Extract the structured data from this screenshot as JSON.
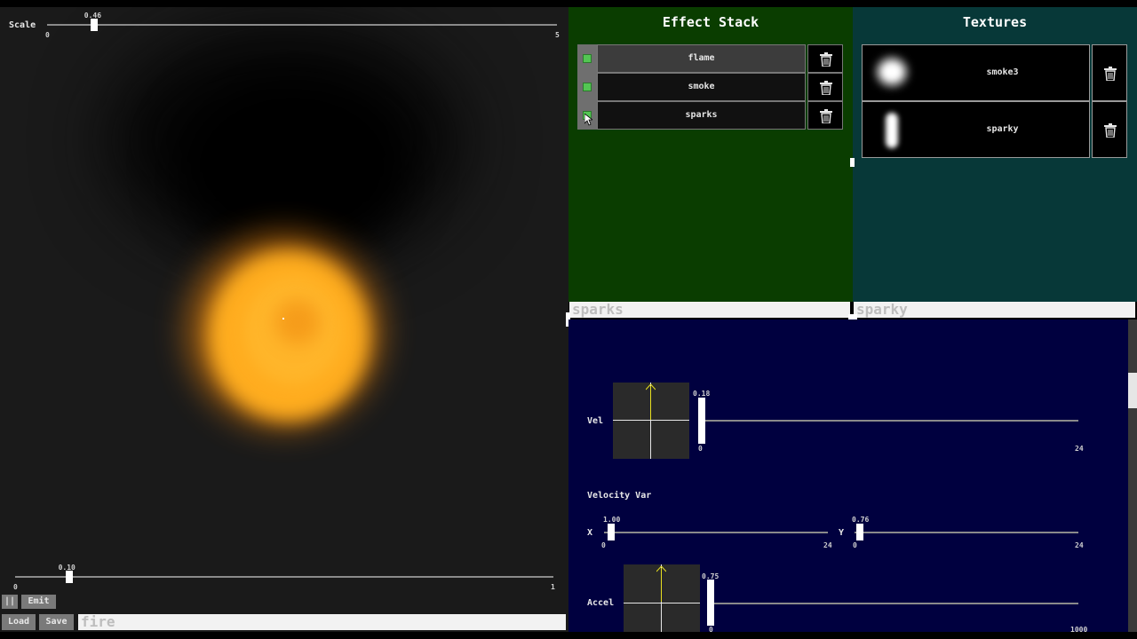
{
  "viewport": {
    "scale_label": "Scale",
    "scale_value": "0.46",
    "scale_min": "0",
    "scale_max": "5",
    "scale_fraction": 0.092,
    "bottom_value": "0.10",
    "bottom_min": "0",
    "bottom_max": "1",
    "bottom_fraction": 0.1
  },
  "toolbar": {
    "pause_label": "||",
    "emit_label": "Emit",
    "load_label": "Load",
    "save_label": "Save",
    "name_value": "fire"
  },
  "effect_stack": {
    "title": "Effect Stack",
    "items": [
      {
        "label": "flame",
        "enabled": true,
        "selected": true
      },
      {
        "label": "smoke",
        "enabled": true,
        "selected": false
      },
      {
        "label": "sparks",
        "enabled": true,
        "selected": false
      }
    ],
    "selected_name_field": "sparks"
  },
  "textures": {
    "title": "Textures",
    "items": [
      {
        "label": "smoke3",
        "thumb": "smoke-thumb"
      },
      {
        "label": "sparky",
        "thumb": "spark-thumb"
      }
    ],
    "selected_name_field": "sparky"
  },
  "properties": {
    "vel": {
      "label": "Vel",
      "value": "0.18",
      "min": "0",
      "max": "24"
    },
    "velocity_var": {
      "label": "Velocity Var",
      "x_label": "X",
      "x_value": "1.00",
      "x_min": "0",
      "x_max": "24",
      "y_label": "Y",
      "y_value": "0.76",
      "y_min": "0",
      "y_max": "24"
    },
    "accel": {
      "label": "Accel",
      "value": "0.75",
      "min": "0",
      "max": "1000"
    }
  },
  "colors": {
    "effect_panel_bg": "#0a3d00",
    "texture_panel_bg": "#073838",
    "props_bg": "#00003f",
    "check_green": "#53c653",
    "flame_orange": "#ffb020"
  }
}
